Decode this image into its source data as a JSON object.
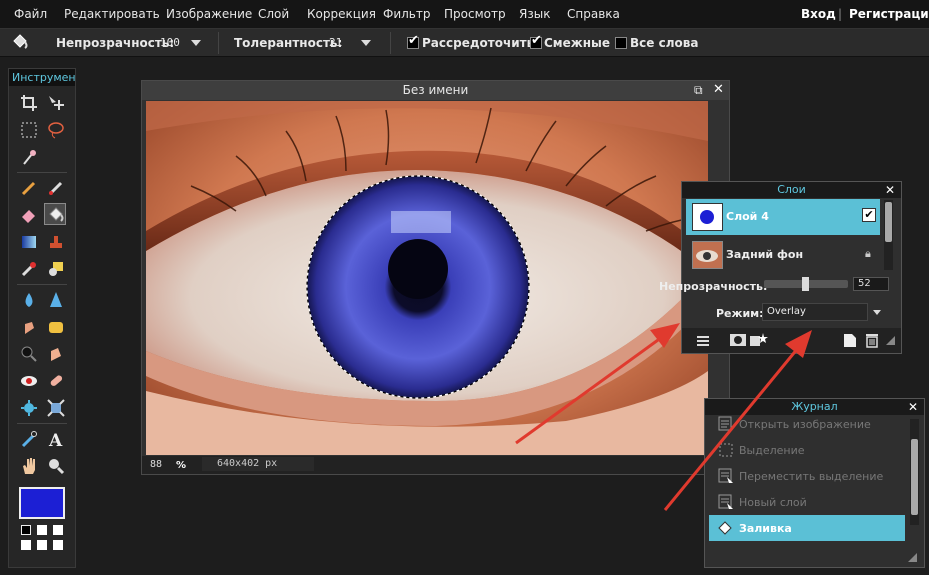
{
  "menubar": {
    "items": [
      "Файл",
      "Редактировать",
      "Изображение",
      "Слой",
      "Коррекция",
      "Фильтр",
      "Просмотр",
      "Язык",
      "Справка"
    ],
    "login": "Вход",
    "separator": "|",
    "register": "Регистрация"
  },
  "options": {
    "opacity_label": "Непрозрачность:",
    "opacity_value": "100",
    "tolerance_label": "Толерантность:",
    "tolerance_value": "21",
    "antialias_label": "Рассредоточить",
    "antialias_checked": true,
    "contiguous_label": "Смежные",
    "contiguous_checked": true,
    "all_layers_label": "Все слова",
    "all_layers_checked": false
  },
  "toolbox": {
    "title": "Инструменты",
    "primary_color": "#1c1fd4",
    "secondary_color": "#ffffff"
  },
  "document": {
    "title": "Без имени",
    "zoom": "88",
    "zoom_unit": "%",
    "dimensions": "640x402 px"
  },
  "layers_panel": {
    "title": "Слои",
    "layers": [
      {
        "name": "Слой 4",
        "visible": true,
        "selected": true
      },
      {
        "name": "Задний фон",
        "locked": true,
        "selected": false
      }
    ],
    "opacity_label": "Непрозрачность:",
    "opacity_value": "52",
    "mode_label": "Режим:",
    "mode_value": "Overlay"
  },
  "history_panel": {
    "title": "Журнал",
    "items": [
      {
        "label": "Открыть изображение",
        "selected": false
      },
      {
        "label": "Выделение",
        "selected": false
      },
      {
        "label": "Переместить выделение",
        "selected": false
      },
      {
        "label": "Новый слой",
        "selected": false
      },
      {
        "label": "Заливка",
        "selected": true
      }
    ]
  },
  "colors": {
    "accent": "#5bc0d6",
    "arrow": "#e03a2e"
  }
}
